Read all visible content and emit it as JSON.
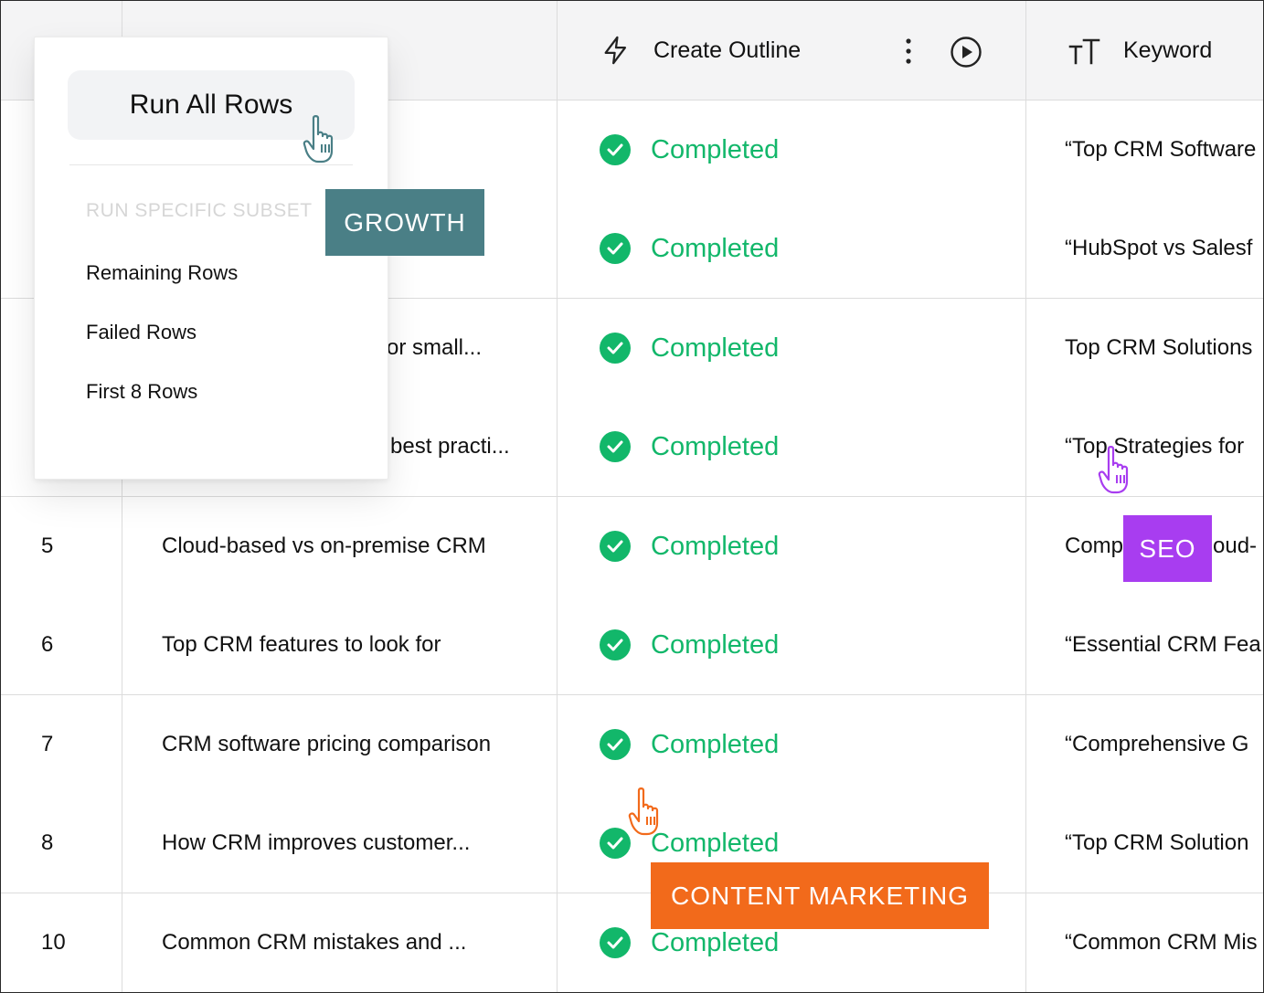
{
  "columns": {
    "outline": {
      "title": "Create Outline",
      "icon": "lightning-icon"
    },
    "keyword": {
      "title": "Keyword",
      "icon": "text-size-icon"
    }
  },
  "rows": [
    {
      "num": "",
      "topic": "",
      "status": "Completed",
      "keyword": "“Top CRM Software"
    },
    {
      "num": "",
      "topic": "",
      "status": "Completed",
      "keyword": "“HubSpot vs Salesf"
    },
    {
      "num": "",
      "topic": "or small...",
      "status": "Completed",
      "keyword": "Top CRM Solutions"
    },
    {
      "num": "",
      "topic": "best practi...",
      "status": "Completed",
      "keyword": "“Top Strategies for"
    },
    {
      "num": "5",
      "topic": "Cloud-based vs on-premise CRM",
      "status": "Completed",
      "keyword": "Comp"
    },
    {
      "num": "6",
      "topic": "Top CRM features to look for",
      "status": "Completed",
      "keyword": "“Essential CRM Fea"
    },
    {
      "num": "7",
      "topic": "CRM software pricing comparison",
      "status": "Completed",
      "keyword": "“Comprehensive G"
    },
    {
      "num": "8",
      "topic": "How CRM improves customer...",
      "status": "Completed",
      "keyword": "“Top CRM Solution"
    },
    {
      "num": "10",
      "topic": "Common CRM mistakes and ...",
      "status": "Completed",
      "keyword": "“Common CRM Mis"
    }
  ],
  "keyword_row5_tail": "oud-",
  "menu": {
    "run_all": "Run All Rows",
    "section": "RUN SPECIFIC SUBSET",
    "items": [
      "Remaining Rows",
      "Failed Rows",
      "First 8 Rows"
    ]
  },
  "tags": {
    "growth": {
      "label": "GROWTH",
      "color": "#4a7f86"
    },
    "seo": {
      "label": "SEO",
      "color": "#a83df0"
    },
    "content": {
      "label": "CONTENT MARKETING",
      "color": "#f26a1b"
    }
  },
  "colors": {
    "status_green": "#12b76a"
  }
}
